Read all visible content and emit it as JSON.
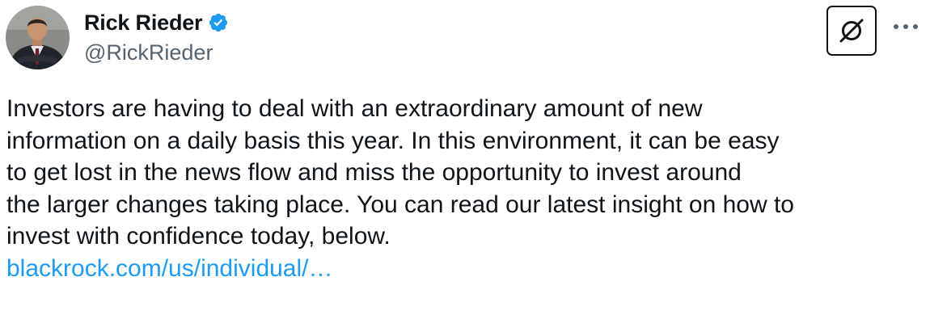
{
  "author": {
    "display_name": "Rick Rieder",
    "handle": "@RickRieder",
    "verified": true,
    "avatar_icon": "profile-photo"
  },
  "actions": {
    "grok_icon": "grok-slash-circle-icon",
    "more_icon": "more-horizontal-icon"
  },
  "tweet": {
    "lines": [
      "Investors are having to deal with an extraordinary amount of new",
      "information on a daily basis this year. In this environment, it can be easy",
      "to get lost in the news flow and miss the opportunity to invest around",
      "the larger changes taking place. You can read our latest insight on how to",
      "invest with confidence today, below."
    ],
    "link_text": "blackrock.com/us/individual/…"
  },
  "colors": {
    "text": "#0f1419",
    "secondary": "#536471",
    "link": "#1d9bf0",
    "verified": "#1d9bf0"
  }
}
